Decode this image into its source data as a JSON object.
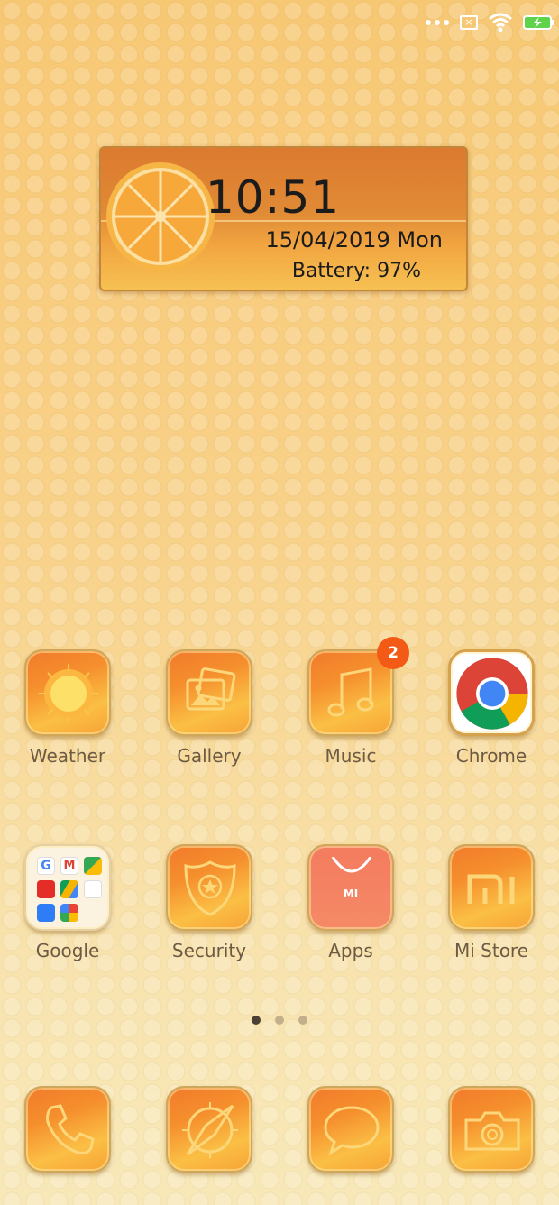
{
  "widget": {
    "time": "10:51",
    "date": "15/04/2019 Mon",
    "battery": "Battery: 97%"
  },
  "apps_row1": [
    {
      "name": "Weather",
      "icon": "sun-icon"
    },
    {
      "name": "Gallery",
      "icon": "gallery-icon"
    },
    {
      "name": "Music",
      "icon": "music-note-icon",
      "badge": "2"
    },
    {
      "name": "Chrome",
      "icon": "chrome-icon"
    }
  ],
  "apps_row2": [
    {
      "name": "Google",
      "icon": "google-folder-icon"
    },
    {
      "name": "Security",
      "icon": "shield-icon"
    },
    {
      "name": "Apps",
      "icon": "mi-bag-icon"
    },
    {
      "name": "Mi Store",
      "icon": "mi-logo-icon"
    }
  ],
  "dock": [
    {
      "icon": "phone-icon"
    },
    {
      "icon": "compass-icon"
    },
    {
      "icon": "message-icon"
    },
    {
      "icon": "camera-icon"
    }
  ],
  "apps_tile_text": "MI",
  "page_indicator": {
    "count": 3,
    "active": 1
  },
  "colors": {
    "tile_orange": "#f58f2d",
    "badge": "#f25a15",
    "label": "#6d5a45"
  }
}
